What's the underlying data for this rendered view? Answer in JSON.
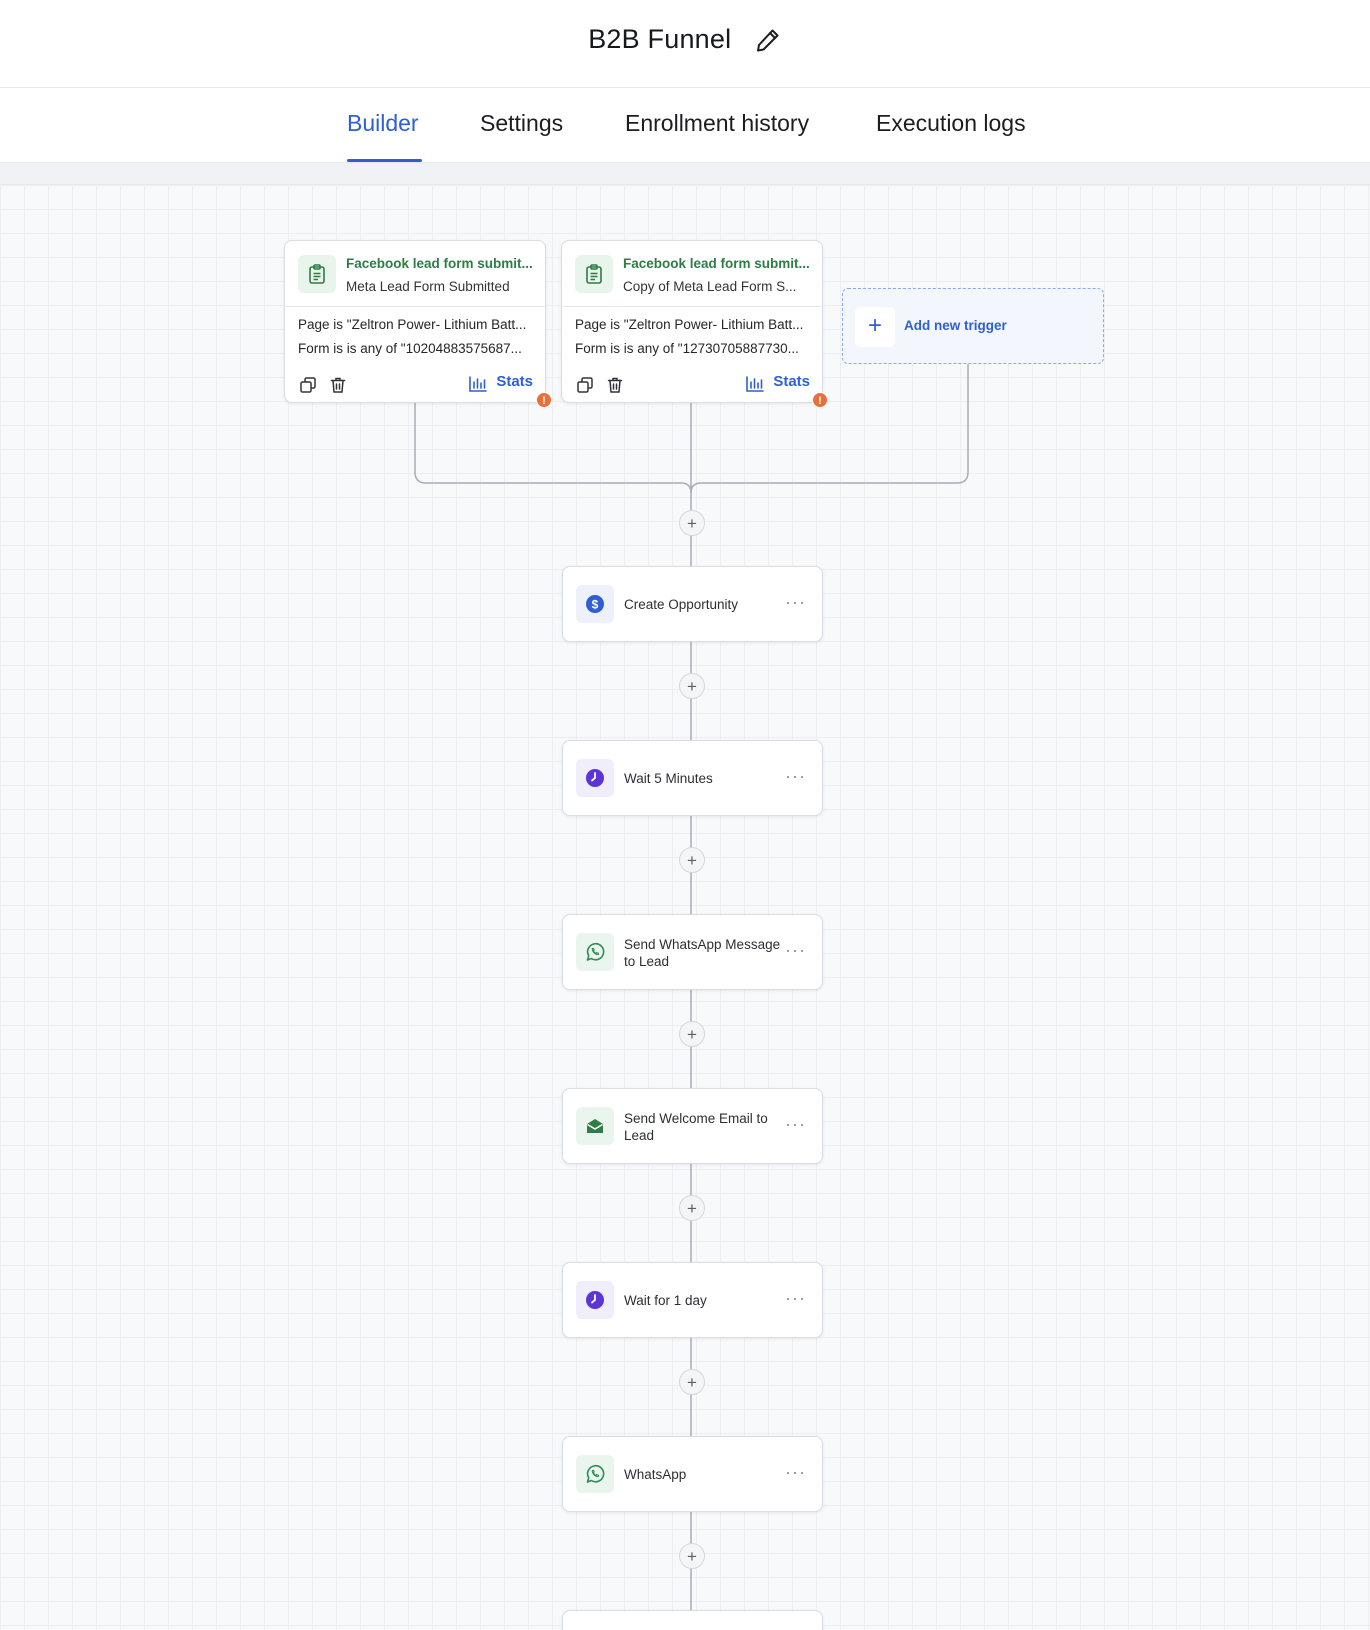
{
  "header": {
    "title": "B2B Funnel",
    "edit_icon": "pencil-icon"
  },
  "tabs": [
    {
      "label": "Builder",
      "active": true
    },
    {
      "label": "Settings",
      "active": false
    },
    {
      "label": "Enrollment history",
      "active": false
    },
    {
      "label": "Execution logs",
      "active": false
    }
  ],
  "colors": {
    "accent": "#2f5fd0",
    "trigger_green": "#2e7d45",
    "warning": "#e8703a",
    "wait_purple": "#5b35d5",
    "whatsapp_green": "#2e8b57"
  },
  "triggers": [
    {
      "title": "Facebook lead form submit...",
      "subtitle": "Meta Lead Form Submitted",
      "line1": "Page is \"Zeltron Power- Lithium Batt...",
      "line2": "Form is is any of \"10204883575687...",
      "stats_label": "Stats",
      "warning": "!"
    },
    {
      "title": "Facebook lead form submit...",
      "subtitle": "Copy of Meta Lead Form S...",
      "line1": "Page is \"Zeltron Power- Lithium Batt...",
      "line2": "Form is is any of \"12730705887730...",
      "stats_label": "Stats",
      "warning": "!"
    }
  ],
  "add_trigger": {
    "label": "Add new trigger",
    "icon": "plus-icon"
  },
  "actions": [
    {
      "label": "Create Opportunity",
      "icon": "dollar-icon"
    },
    {
      "label": "Wait 5 Minutes",
      "icon": "clock-icon"
    },
    {
      "label": "Send WhatsApp Message to Lead",
      "icon": "whatsapp-icon"
    },
    {
      "label": "Send Welcome Email to Lead",
      "icon": "mail-open-icon"
    },
    {
      "label": "Wait for 1 day",
      "icon": "clock-icon"
    },
    {
      "label": "WhatsApp",
      "icon": "whatsapp-icon"
    }
  ],
  "more_glyph": "···",
  "plus_glyph": "+"
}
